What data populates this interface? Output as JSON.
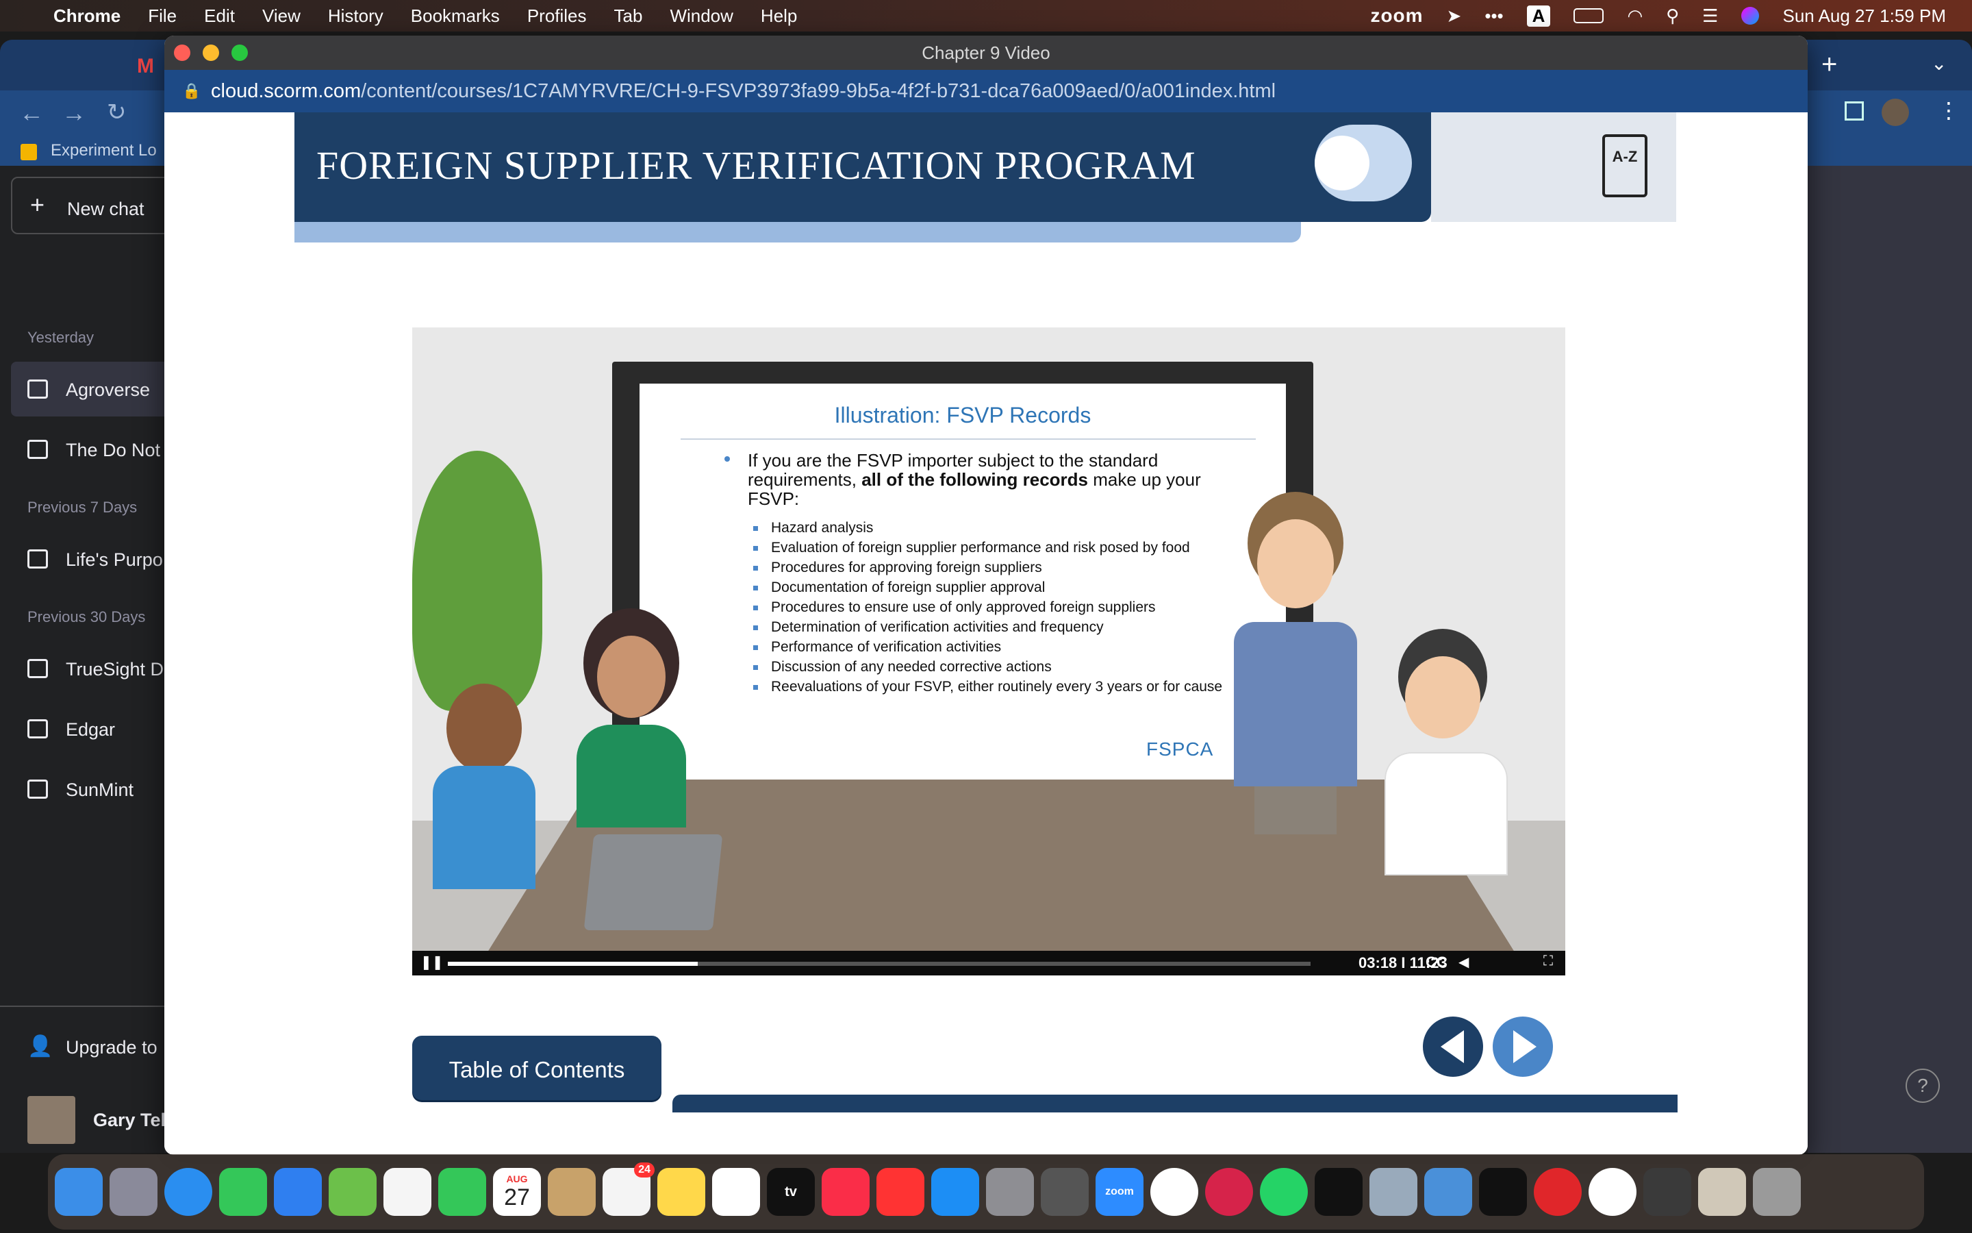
{
  "menubar": {
    "app": "Chrome",
    "items": [
      "File",
      "Edit",
      "View",
      "History",
      "Bookmarks",
      "Profiles",
      "Tab",
      "Window",
      "Help"
    ],
    "zoom_label": "zoom",
    "input_indicator": "A",
    "datetime": "Sun Aug 27  1:59 PM"
  },
  "background_window": {
    "bookmark": "Experiment Lo",
    "sidebar": {
      "new_chat": "New chat",
      "sections": [
        {
          "label": "Yesterday",
          "items": [
            "Agroverse",
            "The Do Not"
          ]
        },
        {
          "label": "Previous 7 Days",
          "items": [
            "Life's Purpo"
          ]
        },
        {
          "label": "Previous 30 Days",
          "items": [
            "TrueSight D",
            "Edgar",
            "SunMint"
          ]
        }
      ],
      "upgrade": "Upgrade to",
      "user": "Gary Tel"
    },
    "help": "?"
  },
  "window": {
    "title": "Chapter 9 Video",
    "url_domain": "cloud.scorm.com",
    "url_path": "/content/courses/1C7AMYRVRE/CH-9-FSVP3973fa99-9b5a-4f2f-b731-dca76a009aed/0/a001index.html"
  },
  "course": {
    "banner_title": "FOREIGN SUPPLIER VERIFICATION PROGRAM",
    "glossary_label": "A-Z",
    "slide": {
      "title": "Illustration: FSVP Records",
      "lead_pre": "If you are the FSVP importer subject to the standard requirements, ",
      "lead_bold": "all of the following records",
      "lead_post": " make up your FSVP:",
      "items": [
        "Hazard analysis",
        "Evaluation of foreign supplier performance and risk posed by food",
        "Procedures for approving foreign suppliers",
        "Documentation of foreign supplier approval",
        "Procedures to ensure use of only approved foreign suppliers",
        "Determination of verification activities and frequency",
        "Performance of verification activities",
        "Discussion of any needed corrective actions",
        "Reevaluations of your FSVP, either routinely every 3 years or for cause"
      ],
      "logo": "FSPCA"
    },
    "player": {
      "timecode": "03:18 I 11:23",
      "cc": "CC",
      "progress": 0.29
    },
    "toc_button": "Table of Contents"
  },
  "dock": {
    "calendar_month": "AUG",
    "calendar_day": "27",
    "reminders_badge": "24",
    "zoom": "zoom",
    "tv": "tv"
  }
}
